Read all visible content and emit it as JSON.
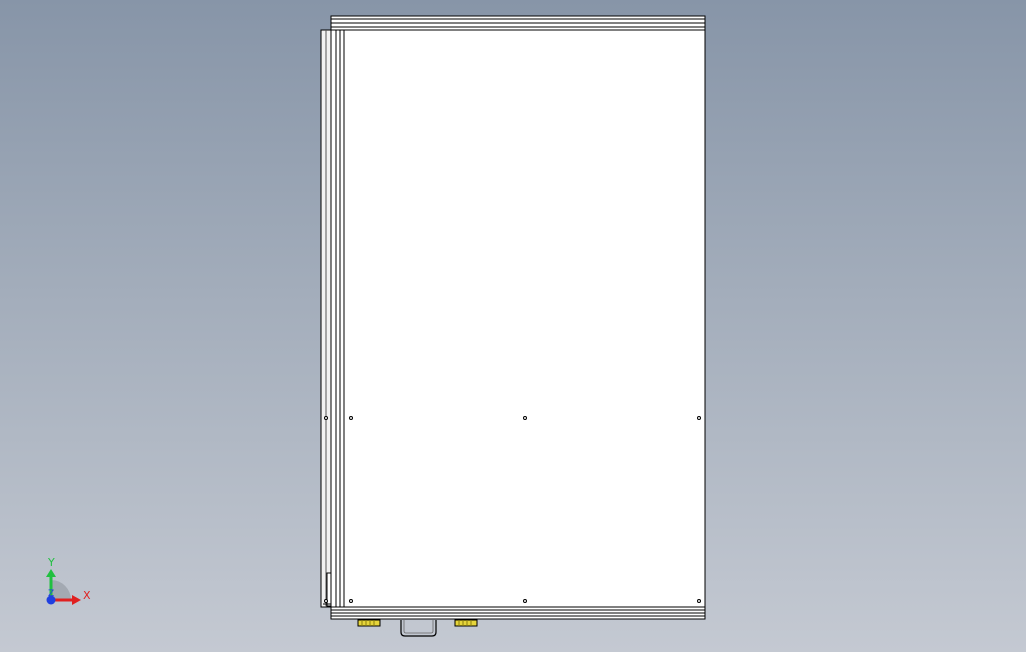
{
  "viewport": {
    "background_top": "#8795a8",
    "background_bottom": "#c4c9d2",
    "panel_fill": "#ffffff",
    "edge_color": "#000000",
    "connector_color": "#e6d53a"
  },
  "triad": {
    "x_label": "X",
    "y_label": "Y",
    "z_label": "Z",
    "x_color": "#e02020",
    "y_color": "#20c040",
    "z_color": "#2040e0"
  }
}
